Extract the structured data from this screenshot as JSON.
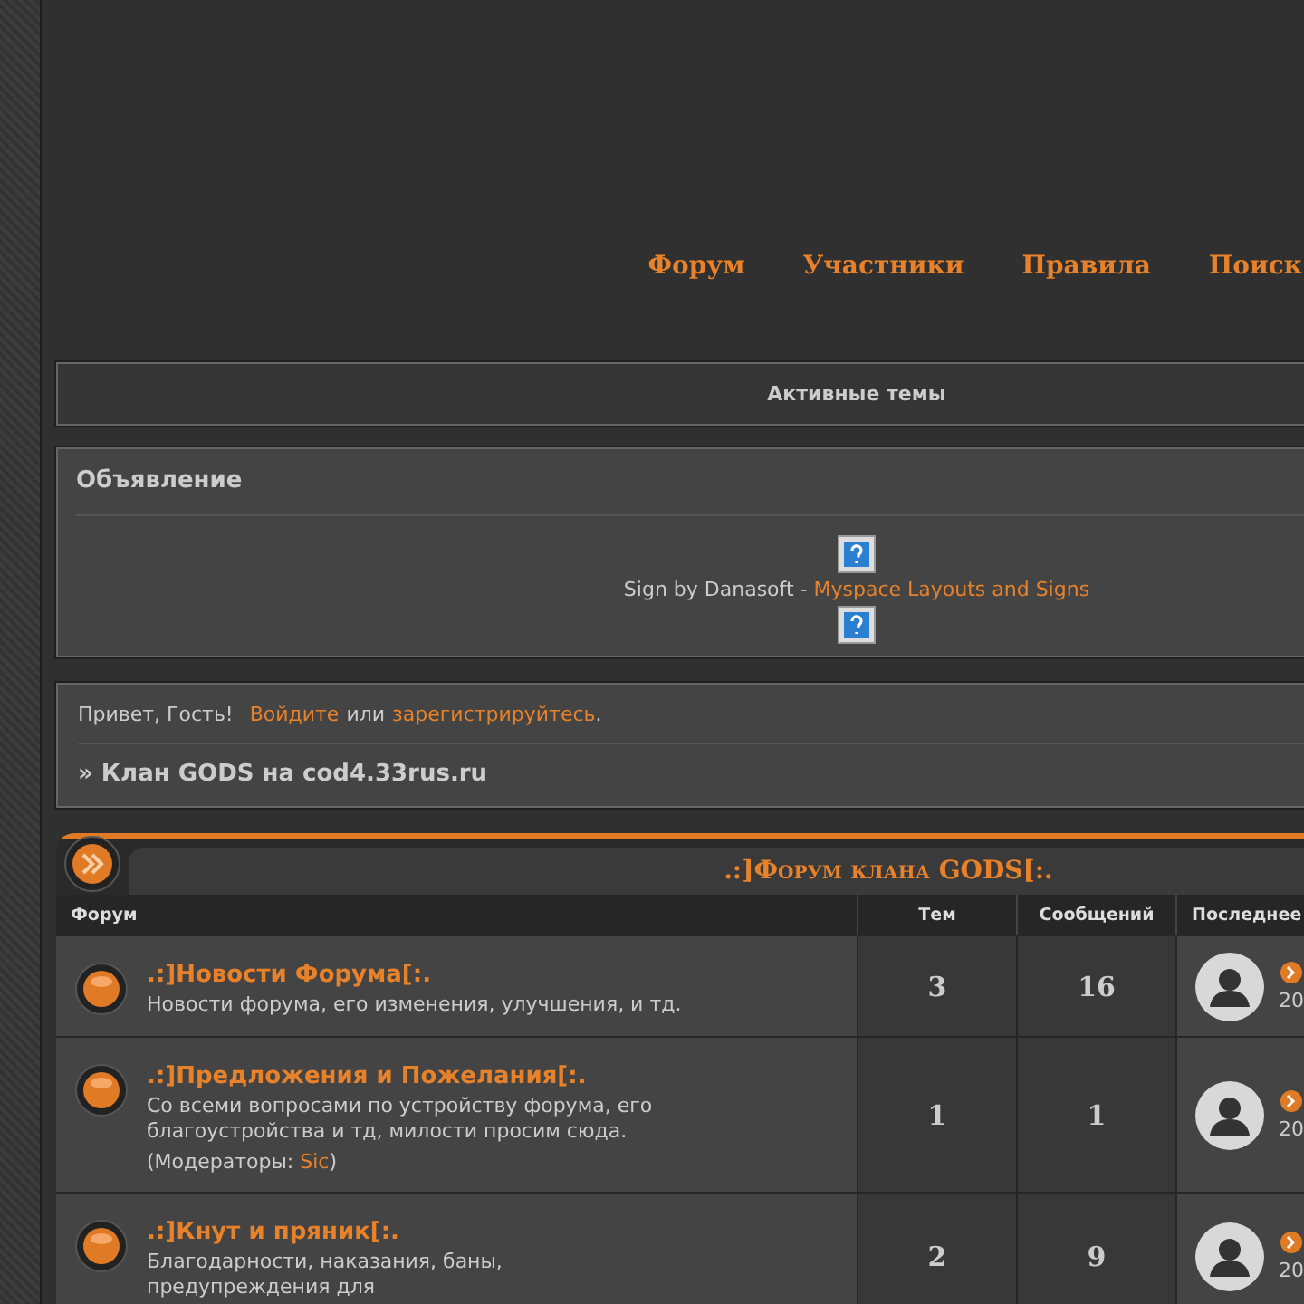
{
  "nav": [
    "Форум",
    "Участники",
    "Правила",
    "Поиск"
  ],
  "active_topics": "Активные темы",
  "announcement": {
    "title": "Объявление",
    "sign_text": "Sign by Danasoft -",
    "sign_link": "Myspace Layouts and Signs"
  },
  "welcome": {
    "greeting": "Привет, Гость!",
    "login": "Войдите",
    "or": "или",
    "register": "зарегистрируйтесь",
    "end": "."
  },
  "breadcrumb": "» Клан GODS на cod4.33rus.ru",
  "forum": {
    "title": ".:]Форум клана GODS[:.",
    "columns": [
      "Форум",
      "Тем",
      "Сообщений",
      "Последнее"
    ],
    "rows": [
      {
        "name": ".:]Новости Форума[:.",
        "description": "Новости форума, его изменения, улучшения, и тд.",
        "moderators_label": "",
        "moderators": [],
        "topics": "3",
        "posts": "16",
        "last_post": "20"
      },
      {
        "name": ".:]Предложения и Пожелания[:.",
        "description": "Со всеми вопросами по устройству форума, его благоустройства и тд, милости просим сюда.",
        "moderators_label": "(Модераторы:",
        "moderators": [
          "Sic"
        ],
        "moderators_end": ")",
        "topics": "1",
        "posts": "1",
        "last_post": "20"
      },
      {
        "name": ".:]Кнут и пряник[:.",
        "description": "Благодарности, наказания, баны, предупреждения для",
        "moderators_label": "",
        "moderators": [],
        "topics": "2",
        "posts": "9",
        "last_post": "20"
      }
    ]
  }
}
